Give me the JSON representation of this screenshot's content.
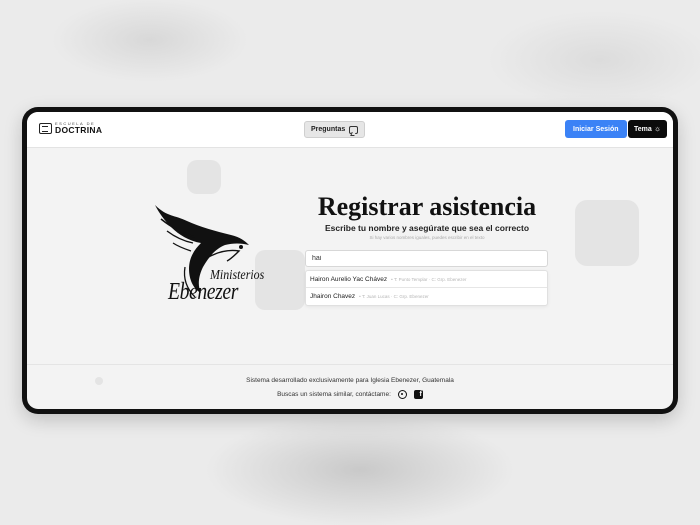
{
  "header": {
    "logo_small": "ESCUELA DE",
    "logo_big": "DOCTRINA",
    "preguntas_label": "Preguntas",
    "login_label": "Iniciar Sesión",
    "theme_label": "Tema"
  },
  "brand": {
    "line1": "Ministerios",
    "line2": "Ebenezer"
  },
  "form": {
    "title": "Registrar asistencia",
    "subtitle": "Escribe tu nombre y asegúrate que sea el correcto",
    "hint": "Si hay varios nombres iguales, puedes escribir en el texto",
    "search_value": "hai",
    "suggestions": [
      {
        "name": "Hairon Aurelio Yac Chávez",
        "meta": "• T: Punto Templar · C: Grp. Ebenezer"
      },
      {
        "name": "Jhairon Chavez",
        "meta": "• T: Juan Lucas · C: Grp. Ebenezer"
      }
    ]
  },
  "footer": {
    "text": "Sistema desarrollado exclusivamente para Iglesia Ebenezer, Guatemala",
    "contact": "Buscas un sistema similar, contáctame:"
  },
  "colors": {
    "login_button": "#3b82f6",
    "theme_button": "#0b0b0b",
    "frame": "#111111"
  }
}
